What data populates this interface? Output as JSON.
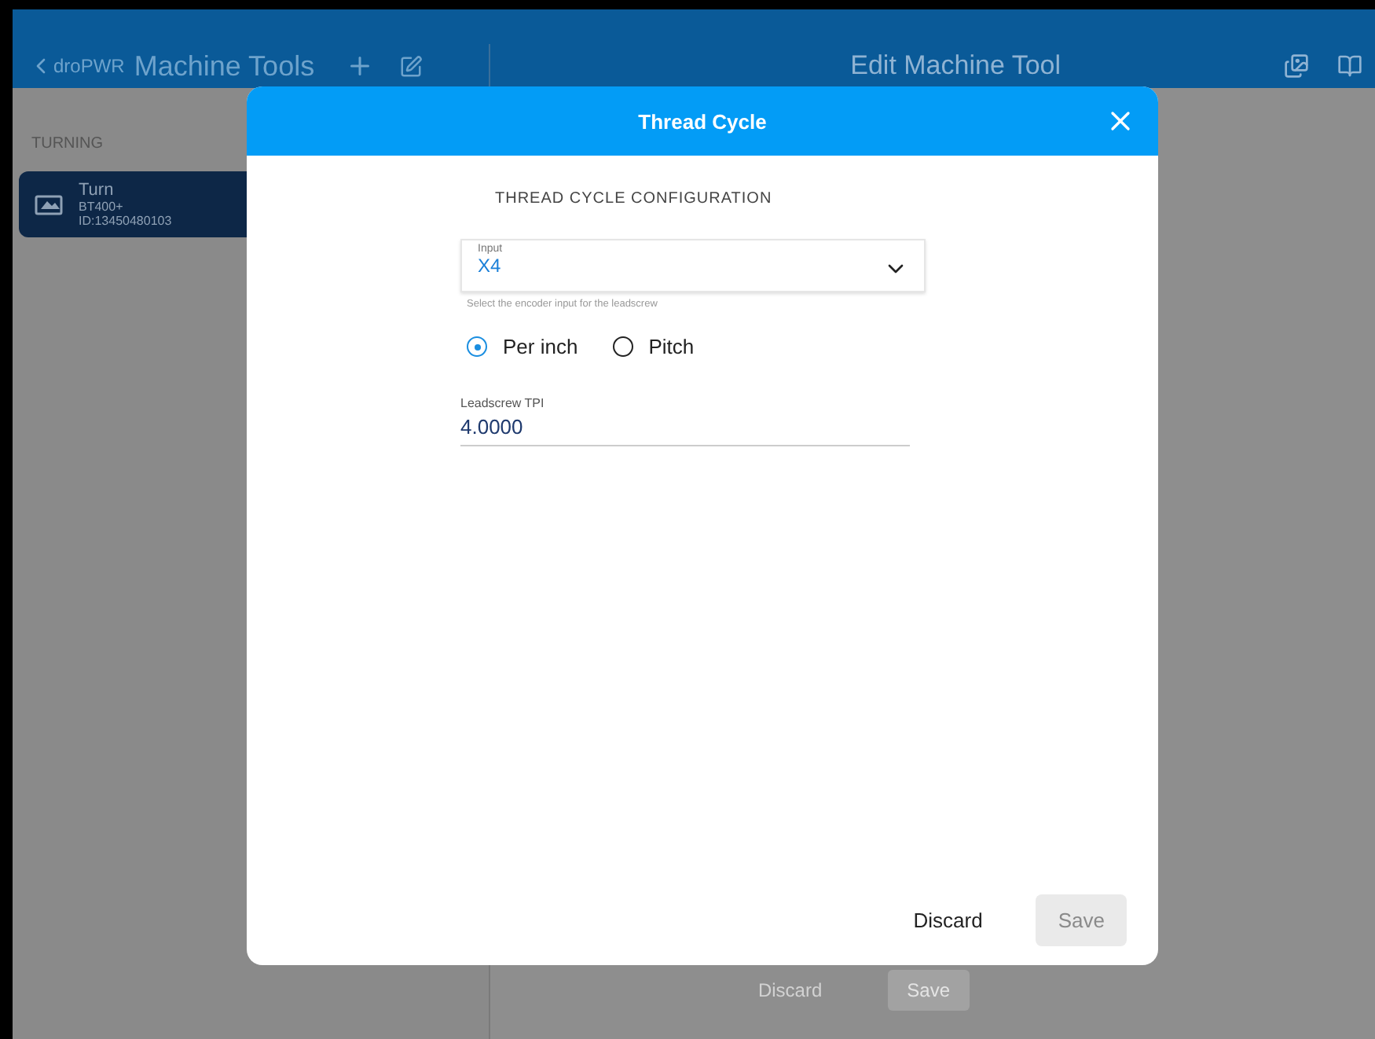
{
  "header": {
    "back_label": "droPWR",
    "title": "Machine Tools",
    "detail_title": "Edit Machine Tool"
  },
  "sidebar": {
    "section": "TURNING",
    "items": [
      {
        "name": "Turn",
        "model": "BT400+",
        "id": "ID:13450480103",
        "selected": true
      }
    ]
  },
  "background_buttons": [
    {
      "label": "Discard",
      "disabled": false
    },
    {
      "label": "Save",
      "disabled": true
    }
  ],
  "dialog": {
    "title": "Thread Cycle",
    "heading": "THREAD CYCLE CONFIGURATION",
    "input": {
      "label": "Input",
      "value": "X4",
      "hint": "Select the encoder input for the leadscrew"
    },
    "options": [
      {
        "label": "Per inch",
        "selected": true
      },
      {
        "label": "Pitch",
        "selected": false
      }
    ],
    "tpi": {
      "label": "Leadscrew TPI",
      "value": "4.0000"
    },
    "buttons": [
      {
        "label": "Discard",
        "disabled": false
      },
      {
        "label": "Save",
        "disabled": true
      }
    ]
  }
}
